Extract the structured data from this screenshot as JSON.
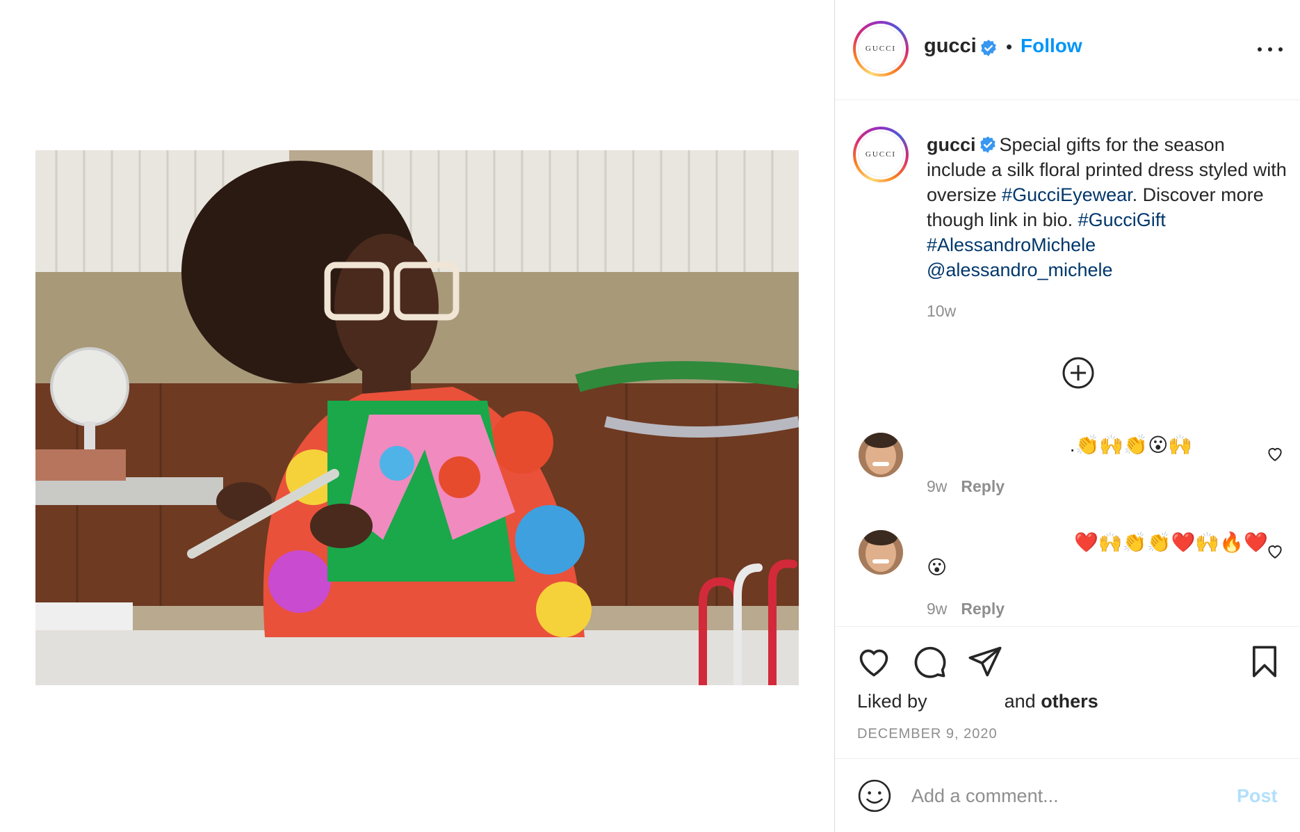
{
  "colors": {
    "accent": "#0095f6",
    "hashtag": "#00376b",
    "muted": "#8e8e8e",
    "verified": "#3897f0",
    "post_disabled": "#b2dffc"
  },
  "post": {
    "image_label": "Gucci campaign photo",
    "header": {
      "username": "gucci",
      "avatar_text": "GUCCI",
      "dot": "•",
      "follow_label": "Follow"
    },
    "caption": {
      "username": "gucci",
      "text_before": "Special gifts for the season include a silk floral printed dress styled with oversize ",
      "tag1": "#GucciEyewear",
      "text_mid": ". Discover more though link in bio. ",
      "tag2": "#GucciGift",
      "tag3": "#AlessandroMichele",
      "mention": "@alessandro_michele",
      "time": "10w"
    },
    "comments": [
      {
        "text": " .👏🙌👏😮🙌",
        "time": "9w",
        "reply_label": "Reply"
      },
      {
        "text": "❤️🙌👏👏❤️🙌🔥❤️",
        "text2": "😮",
        "time": "9w",
        "reply_label": "Reply"
      }
    ],
    "actions": {
      "icons": [
        "heart-icon",
        "comment-icon",
        "share-icon",
        "save-icon"
      ]
    },
    "likes": {
      "prefix": "Liked by",
      "suffix_plain": "and",
      "suffix_bold": "others"
    },
    "date": "DECEMBER 9, 2020",
    "add_comment": {
      "placeholder": "Add a comment...",
      "post_label": "Post"
    }
  }
}
